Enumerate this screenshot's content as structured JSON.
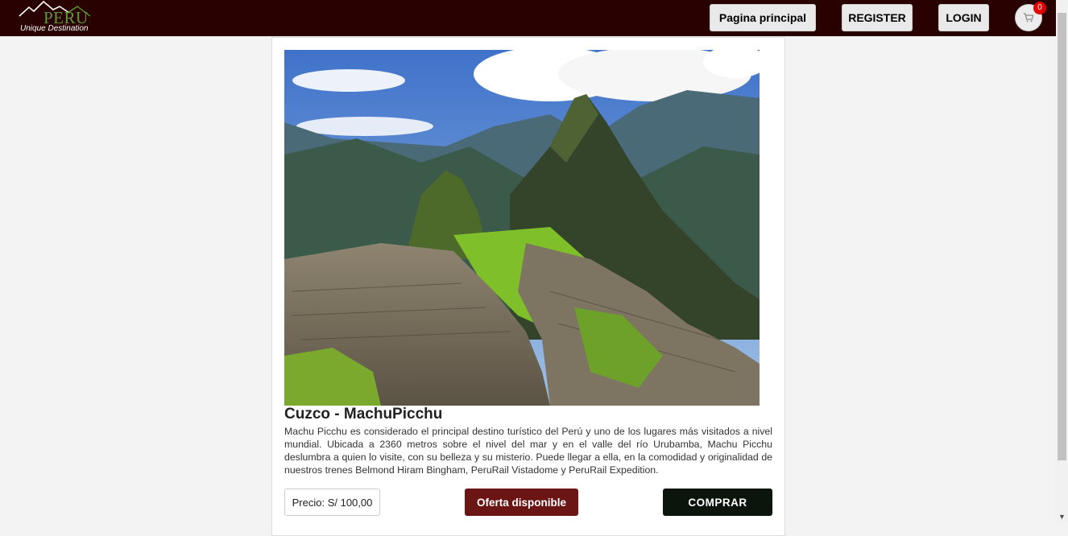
{
  "brand": {
    "name": "PERU",
    "tagline": "Unique Destination"
  },
  "nav": {
    "home_label": "Pagina principal",
    "register_label": "REGISTER",
    "login_label": "LOGIN",
    "cart_count": "0",
    "cart_icon": "cart-icon"
  },
  "product": {
    "title": "Cuzco - MachuPicchu",
    "description": "Machu Picchu es considerado el principal destino turístico del Perú y uno de los lugares más visitados a nivel mundial. Ubicada a 2360 metros sobre el nivel del mar y en el valle del río Urubamba, Machu Picchu deslumbra a quien lo visite, con su belleza y su misterio. Puede llegar a ella, en la comodidad y originalidad de nuestros trenes Belmond Hiram Bingham, PeruRail Vistadome y PeruRail Expedition.",
    "price_label": "Precio: S/ 100,00",
    "offer_label": "Oferta disponible",
    "buy_label": "COMPRAR"
  },
  "colors": {
    "navbar": "#2a0101",
    "offer": "#6b1515",
    "buy": "#0c150c",
    "badge": "#e00000"
  }
}
